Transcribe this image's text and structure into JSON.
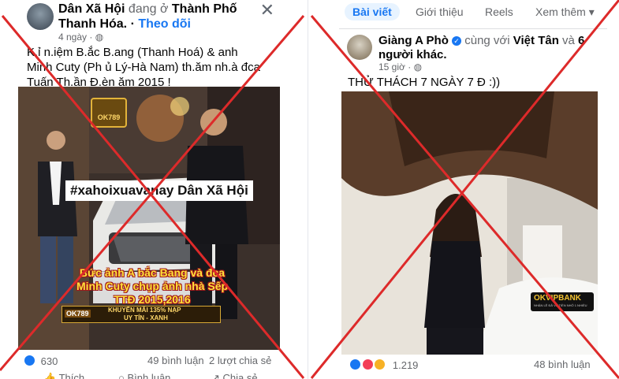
{
  "left_post": {
    "author": "Dân Xã Hội",
    "checkin_text": "đang ở",
    "location": "Thành Phố Thanh Hóa.",
    "follow_label": "Theo dõi",
    "time": "4 ngày",
    "text_line1": "K.ỉ n.iệm    B.ắc B.ang (Thanh Hoá) & anh",
    "text_line2": "Minh Cuty (Ph ủ Lý-Hà Nam) th.ăm nh.à đca",
    "text_line3": "Tuấn Th.ần Đ.èn   ăm 2015 !",
    "photo_hashtag": "#xahoixuavanay Dân Xã Hội",
    "photo_caption1": "Bức ảnh A bắc Bang và đca",
    "photo_caption2": "Minh Cuty chụp ảnh nhà Sếp",
    "photo_caption3": "TTĐ 2015,2016",
    "badge_ok": "OK789",
    "badge_ok2": "OK789",
    "promo_line1": "KHUYẾN MÃI 135% NẠP",
    "promo_line2": "UY TÍN - XANH",
    "reactions_count": "630",
    "comments": "49 bình luận",
    "shares": "2 lượt chia sẻ",
    "action_like": "Thích",
    "action_comment": "Bình luận",
    "action_share": "Chia sẻ"
  },
  "right_post": {
    "tabs": [
      "Bài viết",
      "Giới thiệu",
      "Reels",
      "Xem thêm"
    ],
    "tab_more_arrow": "▾",
    "author": "Giàng A Phò",
    "with_text": "cùng với",
    "tagged": "Việt Tân",
    "and_text": "và",
    "others": "6 người khác.",
    "time": "15 giờ",
    "text": "THỬ THÁCH 7 NGÀY 7 Đ  :))",
    "watermark_brand": "OKVIPBANK",
    "watermark_sub": "NHẬN LÊ ĐÃ VÀ TIỀN NHỎ 1 NHIỀU",
    "reactions_count": "1.219",
    "comments": "48 bình luận"
  },
  "colors": {
    "cross": "#dd2a2a",
    "accent": "#1877f2"
  }
}
